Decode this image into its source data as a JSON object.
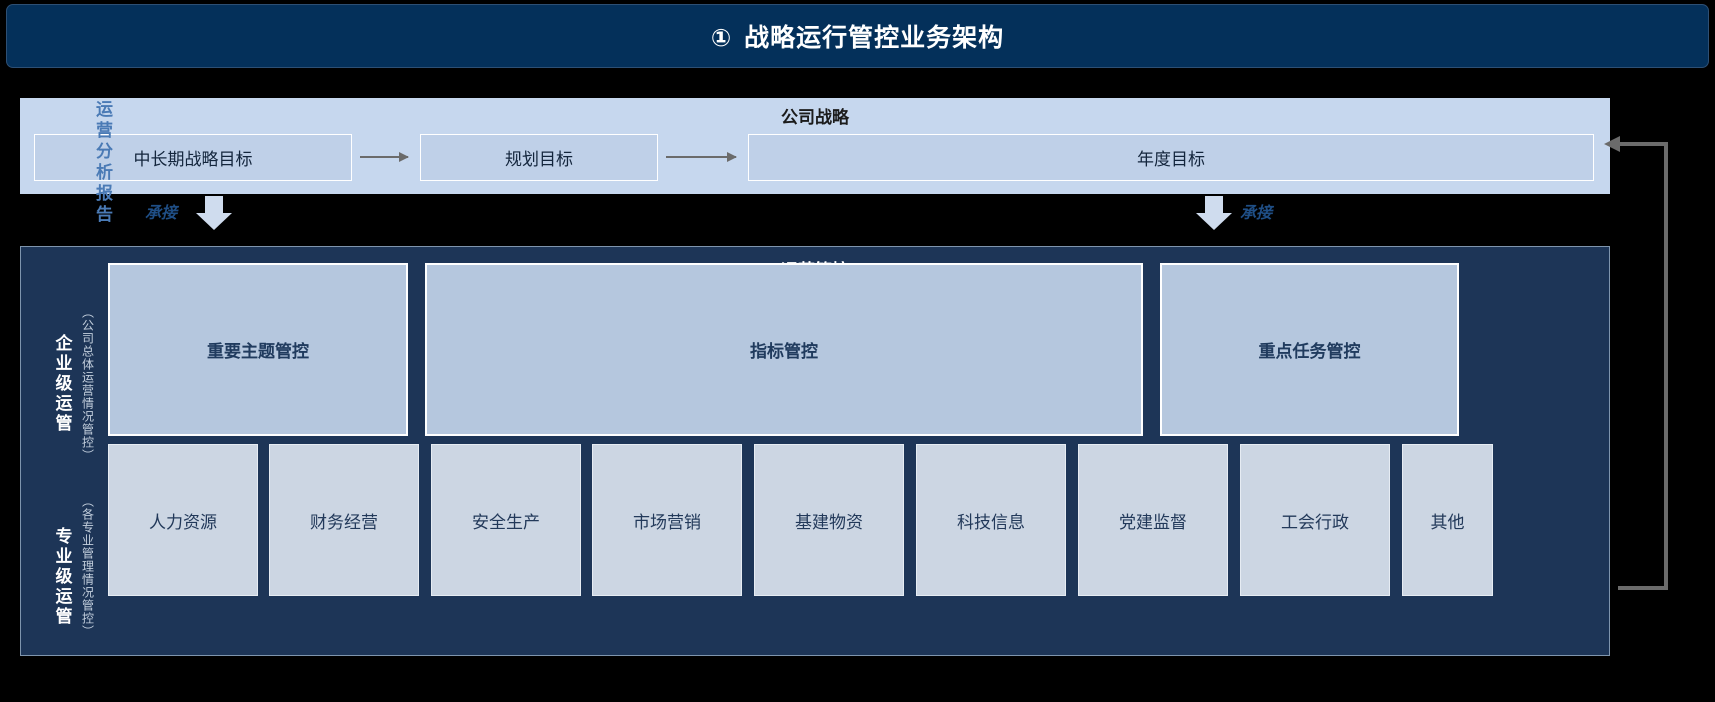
{
  "header": {
    "number": "①",
    "title": "战略运行管控业务架构"
  },
  "strategy": {
    "title": "公司战略",
    "boxes": [
      {
        "label": "中长期战略目标"
      },
      {
        "label": "规划目标"
      },
      {
        "label": "年度目标"
      }
    ]
  },
  "connectors": {
    "cheng_jie_left": "承接",
    "cheng_jie_right": "承接",
    "feedback_label": "运营分析报告"
  },
  "operations": {
    "title": "运营管控",
    "tiers": [
      {
        "vertical_label": "企业级运管",
        "vertical_sub": "（公司总体运营情况管控）",
        "boxes": [
          {
            "label": "重要主题管控"
          },
          {
            "label": "指标管控"
          },
          {
            "label": "重点任务管控"
          }
        ]
      },
      {
        "vertical_label": "专业级运管",
        "vertical_sub": "（各专业管理情况管控）",
        "boxes": [
          {
            "label": "人力资源"
          },
          {
            "label": "财务经营"
          },
          {
            "label": "安全生产"
          },
          {
            "label": "市场营销"
          },
          {
            "label": "基建物资"
          },
          {
            "label": "科技信息"
          },
          {
            "label": "党建监督"
          },
          {
            "label": "工会行政"
          },
          {
            "label": "其他"
          }
        ]
      }
    ]
  },
  "colors": {
    "header_bg": "#04305a",
    "panel_bg": "#1d3557",
    "strategy_bg": "#c6d7ee",
    "tier1_box": "#b5c7de",
    "tier2_box": "#ccd6e3",
    "arrow_gray": "#6b6b6b",
    "accent_blue": "#4a7ab5"
  }
}
